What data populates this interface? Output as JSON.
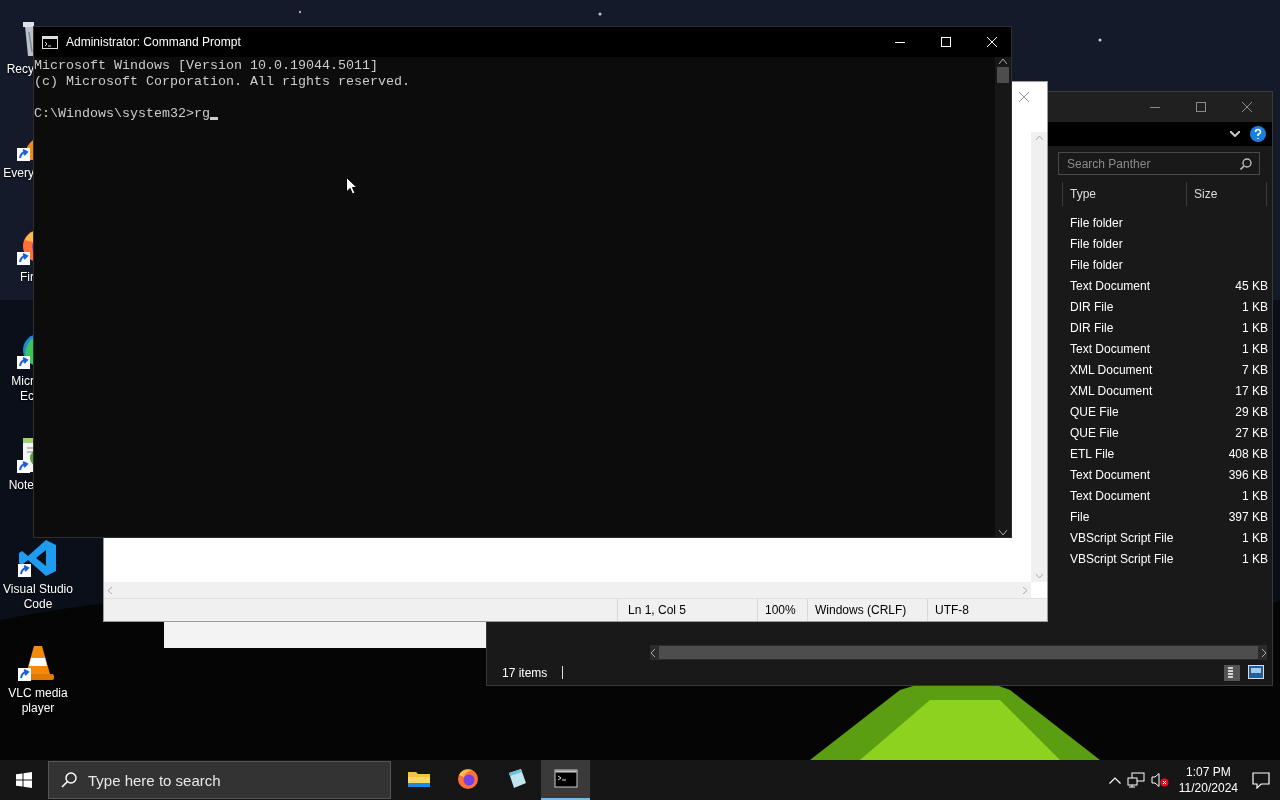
{
  "desktop": {
    "icons": [
      {
        "kind": "recycle-bin",
        "lines": [
          "Recy"
        ]
      },
      {
        "kind": "everything",
        "lines": [
          "Every"
        ]
      },
      {
        "kind": "firefox",
        "lines": [
          "Fir"
        ]
      },
      {
        "kind": "edge",
        "lines": [
          "Micr",
          "Ec"
        ]
      },
      {
        "kind": "notepad",
        "lines": [
          "Note"
        ]
      },
      {
        "kind": "vscode",
        "lines": [
          "Visual Studio",
          "Code"
        ]
      },
      {
        "kind": "vlc",
        "lines": [
          "VLC media",
          "player"
        ]
      }
    ]
  },
  "explorer": {
    "search": {
      "placeholder": "Search Panther"
    },
    "columns": [
      "Type",
      "Size"
    ],
    "rows": [
      {
        "type": "File folder"
      },
      {
        "type": "File folder"
      },
      {
        "type": "File folder"
      },
      {
        "type": "Text Document",
        "size": "45 KB"
      },
      {
        "type": "DIR File",
        "size": "1 KB"
      },
      {
        "type": "DIR File",
        "size": "1 KB"
      },
      {
        "type": "Text Document",
        "size": "1 KB"
      },
      {
        "type": "XML Document",
        "size": "7 KB"
      },
      {
        "type": "XML Document",
        "size": "17 KB"
      },
      {
        "type": "QUE File",
        "size": "29 KB"
      },
      {
        "type": "QUE File",
        "size": "27 KB"
      },
      {
        "type": "ETL File",
        "size": "408 KB"
      },
      {
        "type": "Text Document",
        "size": "396 KB"
      },
      {
        "type": "Text Document",
        "size": "1 KB"
      },
      {
        "type": "File",
        "size": "397 KB"
      },
      {
        "type": "VBScript Script File",
        "size": "1 KB"
      },
      {
        "type": "VBScript Script File",
        "size": "1 KB"
      }
    ],
    "status": "17 items"
  },
  "notepad": {
    "status_bar": [
      "Ln 1, Col 5",
      "100%",
      "Windows (CRLF)",
      "UTF-8"
    ]
  },
  "command_prompt": {
    "title": "Administrator: Command Prompt",
    "output": [
      "Microsoft Windows [Version 10.0.19044.5011]",
      "(c) Microsoft Corporation. All rights reserved."
    ],
    "prompt": "C:\\Windows\\system32>",
    "input": "rg"
  },
  "taskbar": {
    "search": {
      "placeholder": "Type here to search"
    },
    "apps": [
      {
        "kind": "explorer",
        "selected": false
      },
      {
        "kind": "firefox",
        "selected": false
      },
      {
        "kind": "notepad",
        "selected": false
      },
      {
        "kind": "terminal",
        "selected": true
      }
    ],
    "clock": {
      "time": "1:07 PM",
      "date": "11/20/2024"
    }
  }
}
